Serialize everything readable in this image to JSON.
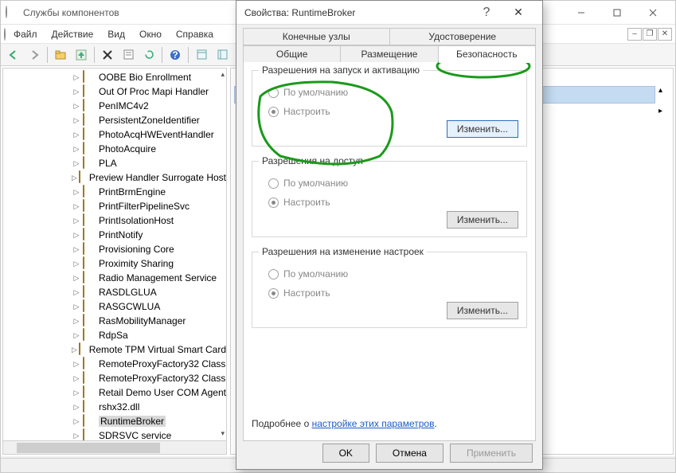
{
  "window": {
    "title": "Службы компонентов"
  },
  "menu": {
    "file": "Файл",
    "action": "Действие",
    "view": "Вид",
    "window": "Окно",
    "help": "Справка"
  },
  "tree": {
    "items": [
      "OOBE Bio Enrollment",
      "Out Of Proc Mapi Handler",
      "PenIMC4v2",
      "PersistentZoneIdentifier",
      "PhotoAcqHWEventHandler",
      "PhotoAcquire",
      "PLA",
      "Preview Handler Surrogate Host",
      "PrintBrmEngine",
      "PrintFilterPipelineSvc",
      "PrintIsolationHost",
      "PrintNotify",
      "Provisioning Core",
      "Proximity Sharing",
      "Radio Management Service",
      "RASDLGLUA",
      "RASGCWLUA",
      "RasMobilityManager",
      "RdpSa",
      "Remote TPM Virtual Smart Card",
      "RemoteProxyFactory32 Class",
      "RemoteProxyFactory32 Class",
      "Retail Demo User COM Agent",
      "rshx32.dll",
      "RuntimeBroker",
      "SDRSVC service"
    ],
    "selected": "RuntimeBroker"
  },
  "dialog": {
    "title": "Свойства: RuntimeBroker",
    "tabs_top": {
      "endpoints": "Конечные узлы",
      "identity": "Удостоверение"
    },
    "tabs_bottom": {
      "general": "Общие",
      "location": "Размещение",
      "security": "Безопасность"
    },
    "group1": {
      "title": "Разрешения на запуск и активацию",
      "radio_default": "По умолчанию",
      "radio_custom": "Настроить",
      "button": "Изменить..."
    },
    "group2": {
      "title": "Разрешения на доступ",
      "radio_default": "По умолчанию",
      "radio_custom": "Настроить",
      "button": "Изменить..."
    },
    "group3": {
      "title": "Разрешения на изменение настроек",
      "radio_default": "По умолчанию",
      "radio_custom": "Настроить",
      "button": "Изменить..."
    },
    "footer_prefix": "Подробнее о ",
    "footer_link": "настройке этих параметров",
    "footer_suffix": ".",
    "buttons": {
      "ok": "OK",
      "cancel": "Отмена",
      "apply": "Применить"
    }
  }
}
